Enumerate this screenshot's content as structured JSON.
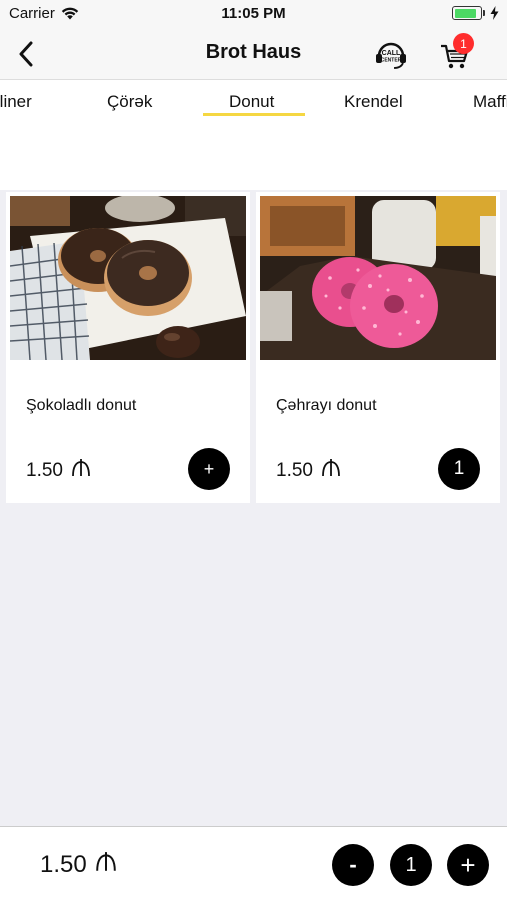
{
  "status_bar": {
    "carrier": "Carrier",
    "time": "11:05 PM",
    "battery_percent": 85
  },
  "nav": {
    "title": "Brot Haus",
    "cart_count": "1",
    "call_center_text": [
      "CALL",
      "CENTER"
    ]
  },
  "tabs": [
    {
      "label": "rliner",
      "active": false
    },
    {
      "label": "Çörək",
      "active": false
    },
    {
      "label": "Donut",
      "active": true
    },
    {
      "label": "Krendel",
      "active": false
    },
    {
      "label": "Maffin",
      "active": false
    }
  ],
  "products": [
    {
      "name": "Şokoladlı donut",
      "price": "1.50",
      "currency_symbol": "₼",
      "action": "+",
      "image": "chocolate-donut-photo"
    },
    {
      "name": "Çəhrayı donut",
      "price": "1.50",
      "currency_symbol": "₼",
      "action": "1",
      "image": "pink-donut-photo"
    }
  ],
  "bottom_bar": {
    "total": "1.50",
    "currency_symbol": "₼",
    "minus_label": "-",
    "quantity": "1",
    "plus_label": "+"
  },
  "colors": {
    "active_tab_underline": "#f5d742",
    "badge": "#ff2d2d",
    "button": "#000000",
    "battery": "#4cd964"
  }
}
